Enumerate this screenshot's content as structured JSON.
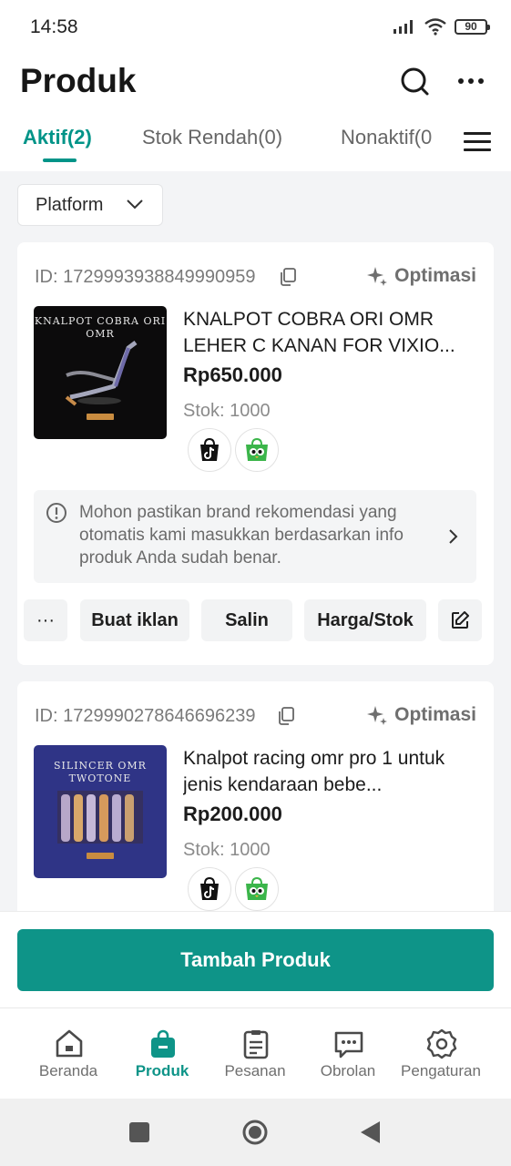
{
  "status_bar": {
    "time": "14:58",
    "battery": "90",
    "icons": [
      "signal-icon",
      "wifi-icon",
      "battery-icon"
    ]
  },
  "header": {
    "title": "Produk",
    "icons": [
      "search-icon",
      "more-icon"
    ]
  },
  "tabs": [
    {
      "label": "Aktif(2)",
      "active": true
    },
    {
      "label": "Stok Rendah(0)",
      "active": false
    },
    {
      "label": "Nonaktif(0",
      "active": false
    }
  ],
  "filter": {
    "label": "Platform"
  },
  "products": [
    {
      "id": "ID: 1729993938849990959",
      "optimize_label": "Optimasi",
      "thumb_text": "KNALPOT COBRA ORI OMR",
      "name": "KNALPOT COBRA ORI OMR LEHER C KANAN FOR VIXIO...",
      "price": "Rp650.000",
      "stock": "Stok: 1000",
      "platforms": [
        "tiktok-shop-icon",
        "tokopedia-icon"
      ]
    },
    {
      "id": "ID: 1729990278646696239",
      "optimize_label": "Optimasi",
      "thumb_text": "SILINCER OMR TWOTONE",
      "name": "Knalpot racing omr pro 1 untuk jenis kendaraan bebe...",
      "price": "Rp200.000",
      "stock": "Stok: 1000",
      "platforms": [
        "tiktok-shop-icon",
        "tokopedia-icon"
      ]
    }
  ],
  "notice": {
    "text": "Mohon pastikan brand rekomendasi yang otomatis kami masukkan berdasarkan info produk Anda sudah benar."
  },
  "card_actions": {
    "more": "···",
    "ad": "Buat iklan",
    "copy": "Salin",
    "price_stock": "Harga/Stok"
  },
  "add_button": "Tambah Produk",
  "bottom_nav": [
    {
      "label": "Beranda",
      "icon": "home-icon",
      "active": false
    },
    {
      "label": "Produk",
      "icon": "bag-icon",
      "active": true
    },
    {
      "label": "Pesanan",
      "icon": "clipboard-icon",
      "active": false
    },
    {
      "label": "Obrolan",
      "icon": "chat-icon",
      "active": false
    },
    {
      "label": "Pengaturan",
      "icon": "gear-icon",
      "active": false
    }
  ],
  "colors": {
    "accent": "#0e9488",
    "tab_active": "#009488",
    "background": "#f3f4f6"
  }
}
